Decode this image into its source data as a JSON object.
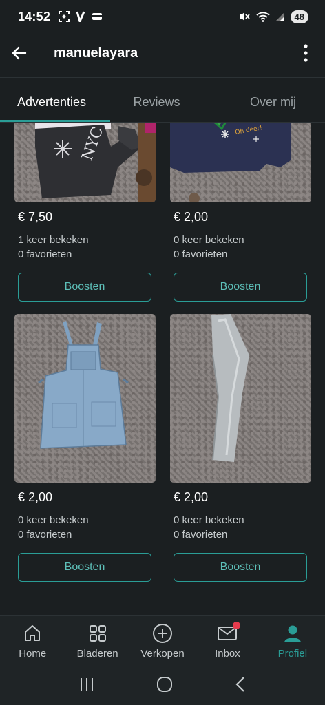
{
  "status_bar": {
    "time": "14:52",
    "battery": "48",
    "icons": [
      "screenshot-icon",
      "vinted-notification-icon",
      "wallet-icon",
      "mute-icon",
      "wifi-icon",
      "signal-icon"
    ]
  },
  "app_bar": {
    "title": "manuelayara",
    "back_icon": "arrow-left-icon",
    "more_icon": "more-vertical-icon"
  },
  "tabs": [
    {
      "label": "Advertenties",
      "active": true
    },
    {
      "label": "Reviews",
      "active": false
    },
    {
      "label": "Over mij",
      "active": false
    }
  ],
  "listings": [
    {
      "image": "black-hoodie-photo",
      "price": "€ 7,50",
      "views": "1 keer bekeken",
      "favorites": "0 favorieten",
      "button": "Boosten"
    },
    {
      "image": "navy-christmas-sweater-photo",
      "price": "€ 2,00",
      "views": "0 keer bekeken",
      "favorites": "0 favorieten",
      "button": "Boosten"
    },
    {
      "image": "denim-dungaree-dress-photo",
      "price": "€ 2,00",
      "views": "0 keer bekeken",
      "favorites": "0 favorieten",
      "button": "Boosten"
    },
    {
      "image": "silver-leggings-photo",
      "price": "€ 2,00",
      "views": "0 keer bekeken",
      "favorites": "0 favorieten",
      "button": "Boosten"
    }
  ],
  "bottom_nav": [
    {
      "label": "Home",
      "icon": "home-icon",
      "active": false
    },
    {
      "label": "Bladeren",
      "icon": "grid-icon",
      "active": false
    },
    {
      "label": "Verkopen",
      "icon": "plus-circle-icon",
      "active": false
    },
    {
      "label": "Inbox",
      "icon": "mail-icon",
      "active": false,
      "badge": true
    },
    {
      "label": "Profiel",
      "icon": "profile-icon",
      "active": true
    }
  ],
  "colors": {
    "background": "#1b1f21",
    "accent": "#2a9d96",
    "badge": "#e53b4d"
  }
}
